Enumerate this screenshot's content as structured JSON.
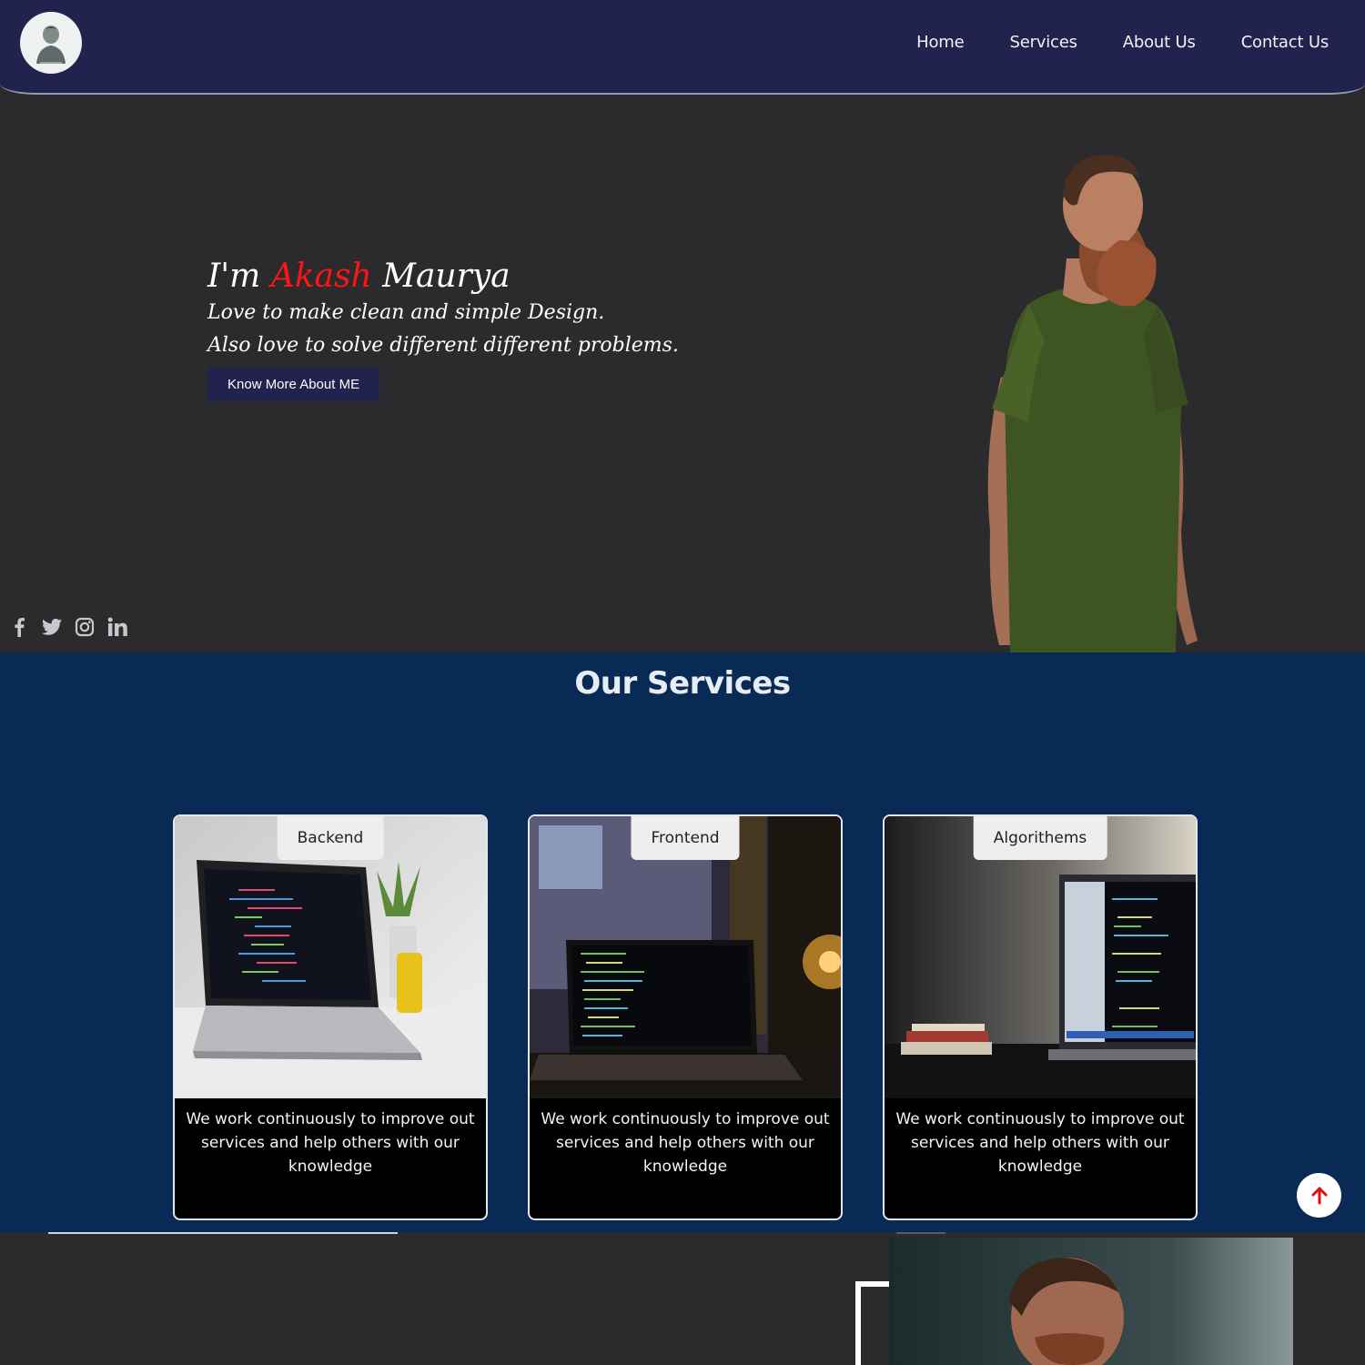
{
  "nav": {
    "logo_icon": "person-portrait-icon",
    "links": [
      "Home",
      "Services",
      "About Us",
      "Contact Us"
    ]
  },
  "hero": {
    "title_prefix": "I'm",
    "title_highlight": "Akash",
    "title_suffix": "Maurya",
    "line1": "Love to make clean and simple Design.",
    "line2": "Also love to solve different different problems.",
    "button": "Know More About ME",
    "socials": [
      "facebook-icon",
      "twitter-icon",
      "instagram-icon",
      "linkedin-icon"
    ],
    "colors": {
      "highlight": "#ff1515",
      "nav_bg": "#22224f",
      "hero_bg": "#2b2a2c"
    }
  },
  "services": {
    "title": "Our Services",
    "bg_color": "#082a55",
    "cards": [
      {
        "tag": "Backend",
        "text": "We work continuously to improve out services and help others with our knowledge"
      },
      {
        "tag": "Frontend",
        "text": "We work continuously to improve out services and help others with our knowledge"
      },
      {
        "tag": "Algorithems",
        "text": "We work continuously to improve out services and help others with our knowledge"
      }
    ]
  },
  "scroll_top": {
    "icon": "arrow-up-icon"
  }
}
